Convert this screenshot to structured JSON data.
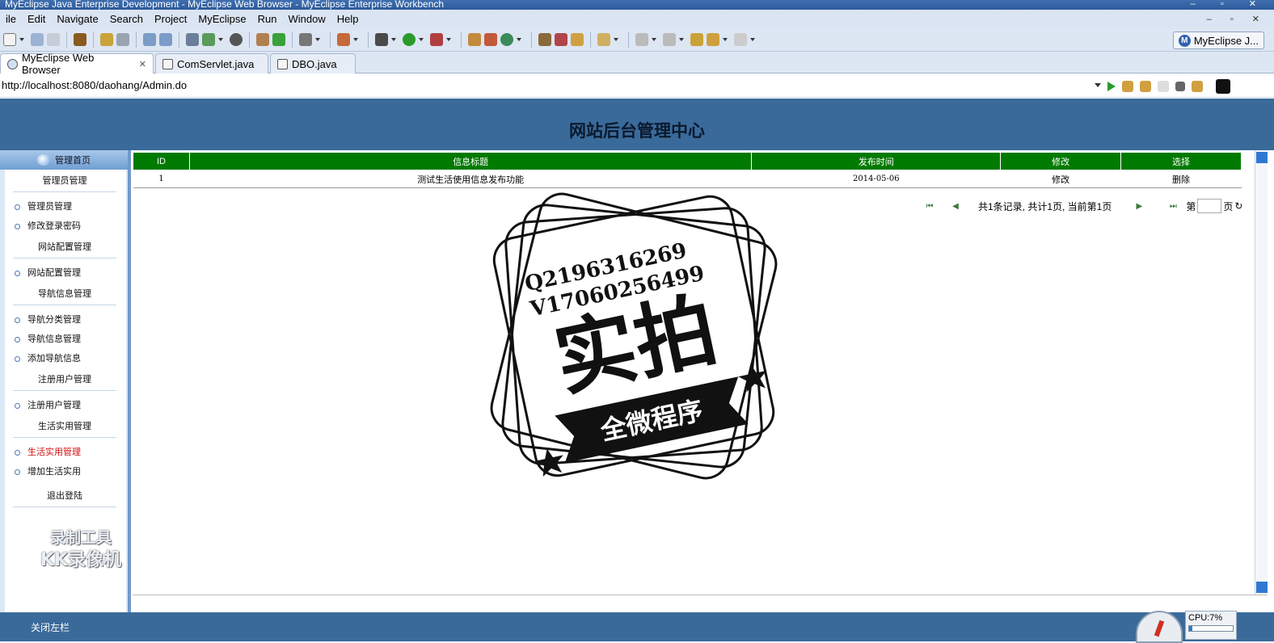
{
  "window": {
    "title": "MyEclipse Java Enterprise Development - MyEclipse Web Browser - MyEclipse Enterprise Workbench",
    "controls": "– ▫ ✕"
  },
  "menubar": {
    "items": [
      "ile",
      "Edit",
      "Navigate",
      "Search",
      "Project",
      "MyEclipse",
      "Run",
      "Window",
      "Help"
    ],
    "right_controls": "– ▫ ✕"
  },
  "toolbar": {
    "perspective_label": "MyEclipse J..."
  },
  "tabs": [
    {
      "label": "MyEclipse Web Browser",
      "active": true
    },
    {
      "label": "ComServlet.java",
      "active": false
    },
    {
      "label": "DBO.java",
      "active": false
    }
  ],
  "browser": {
    "url": "http://localhost:8080/daohang/Admin.do"
  },
  "page": {
    "header_title": "网站后台管理中心",
    "sidebar": {
      "home_label": "管理首页",
      "groups": [
        {
          "title": "管理员管理",
          "items": [
            "管理员管理",
            "修改登录密码"
          ]
        },
        {
          "title": "网站配置管理",
          "items": [
            "网站配置管理"
          ]
        },
        {
          "title": "导航信息管理",
          "items": [
            "导航分类管理",
            "导航信息管理",
            "添加导航信息"
          ]
        },
        {
          "title": "注册用户管理",
          "items": [
            "注册用户管理"
          ]
        },
        {
          "title": "生活实用管理",
          "items": [
            "生活实用管理",
            "增加生活实用"
          ]
        }
      ],
      "logout": "退出登陆",
      "active_item_color": "#d01010"
    },
    "table": {
      "columns": [
        "ID",
        "信息标题",
        "发布时间",
        "修改",
        "选择"
      ],
      "rows": [
        [
          "1",
          "测试生活使用信息发布功能",
          "2014-05-06",
          "修改",
          "删除"
        ]
      ],
      "header_color": "#007a00"
    },
    "pager": {
      "summary": "共1条记录, 共计1页, 当前第1页",
      "page_prefix": "第",
      "page_suffix": "页"
    },
    "footer": {
      "close_left": "关闭左栏"
    }
  },
  "watermark": {
    "line1": "录制工具",
    "line2": "KK录像机"
  },
  "stamp": {
    "qq": "Q2196316269",
    "wechat": "V17060256499",
    "big_text": "实拍",
    "banner": "全微程序"
  },
  "system": {
    "cpu_label": "CPU:7%",
    "cpu_percent": 7
  }
}
